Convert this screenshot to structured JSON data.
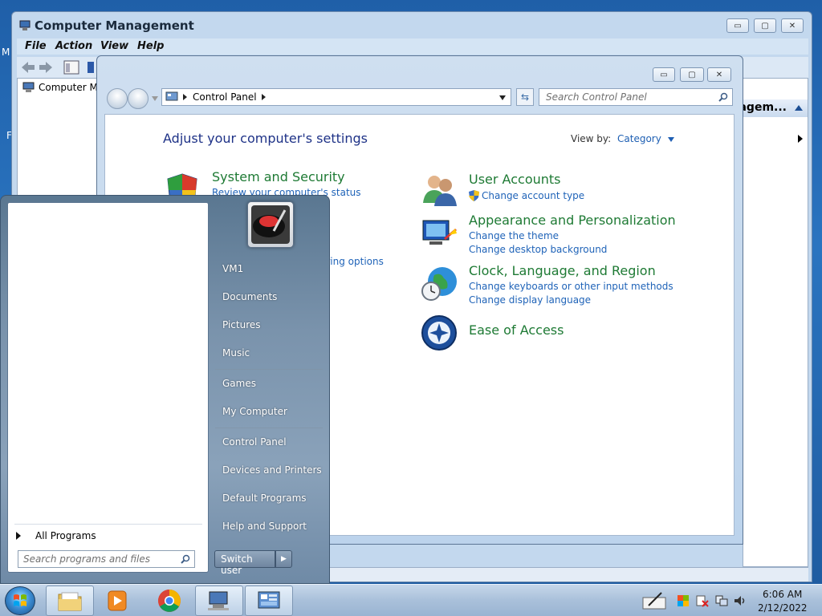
{
  "desktop": {
    "edge_label_1": "M",
    "edge_label_2": "F"
  },
  "computer_management": {
    "title": "Computer Management",
    "menu": [
      "File",
      "Action",
      "View",
      "Help"
    ],
    "tree_item": "Computer Ma",
    "actions_header": "nagem...",
    "buttons": {
      "minimize": "▭",
      "maximize": "▢",
      "close": "✕"
    }
  },
  "control_panel": {
    "address": {
      "root_label": "Control Panel"
    },
    "search_placeholder": "Search Control Panel",
    "heading": "Adjust your computer's settings",
    "view_by_label": "View by:",
    "view_by_value": "Category",
    "categories_left": [
      {
        "title": "System and Security",
        "links": [
          "Review your computer's status"
        ]
      },
      {
        "title": "",
        "links": [
          "aring options"
        ]
      }
    ],
    "categories_right": [
      {
        "title": "User Accounts",
        "links": [
          "Change account type"
        ]
      },
      {
        "title": "Appearance and Personalization",
        "links": [
          "Change the theme",
          "Change desktop background"
        ]
      },
      {
        "title": "Clock, Language, and Region",
        "links": [
          "Change keyboards or other input methods",
          "Change display language"
        ]
      },
      {
        "title": "Ease of Access",
        "links": []
      }
    ]
  },
  "start_menu": {
    "all_programs": "All Programs",
    "search_placeholder": "Search programs and files",
    "right_items": [
      "VM1",
      "Documents",
      "Pictures",
      "Music",
      "Games",
      "My Computer",
      "Control Panel",
      "Devices and Printers",
      "Default Programs",
      "Help and Support"
    ],
    "switch_user": "Switch user"
  },
  "taskbar": {
    "apps": [
      "file-explorer",
      "media-player",
      "chrome",
      "computer-management",
      "control-panel"
    ],
    "clock": {
      "time": "6:06 AM",
      "date": "2/12/2022"
    }
  }
}
